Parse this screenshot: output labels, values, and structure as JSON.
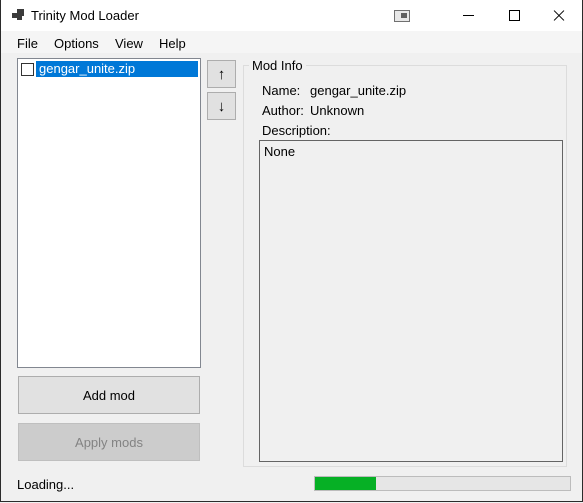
{
  "window": {
    "title": "Trinity Mod Loader",
    "icons": {
      "app": "app-logo-icon",
      "extra": "window-snap-icon",
      "minimize": "minimize-icon",
      "maximize": "maximize-icon",
      "close": "close-icon"
    }
  },
  "menu": {
    "items": [
      {
        "label": "File"
      },
      {
        "label": "Options"
      },
      {
        "label": "View"
      },
      {
        "label": "Help"
      }
    ]
  },
  "mod_list": {
    "items": [
      {
        "name": "gengar_unite.zip",
        "checked": false,
        "selected": true
      }
    ]
  },
  "order_buttons": {
    "up_label": "↑",
    "down_label": "↓"
  },
  "actions": {
    "add_label": "Add mod",
    "apply_label": "Apply mods",
    "apply_enabled": false
  },
  "mod_info": {
    "title": "Mod Info",
    "name_label": "Name:",
    "name_value": "gengar_unite.zip",
    "author_label": "Author:",
    "author_value": "Unknown",
    "description_label": "Description:",
    "description_value": "None"
  },
  "status": {
    "text": "Loading...",
    "progress": 0.24,
    "progress_color": "#06b025"
  },
  "colors": {
    "selection": "#0078d7",
    "background": "#f0f0f0"
  }
}
